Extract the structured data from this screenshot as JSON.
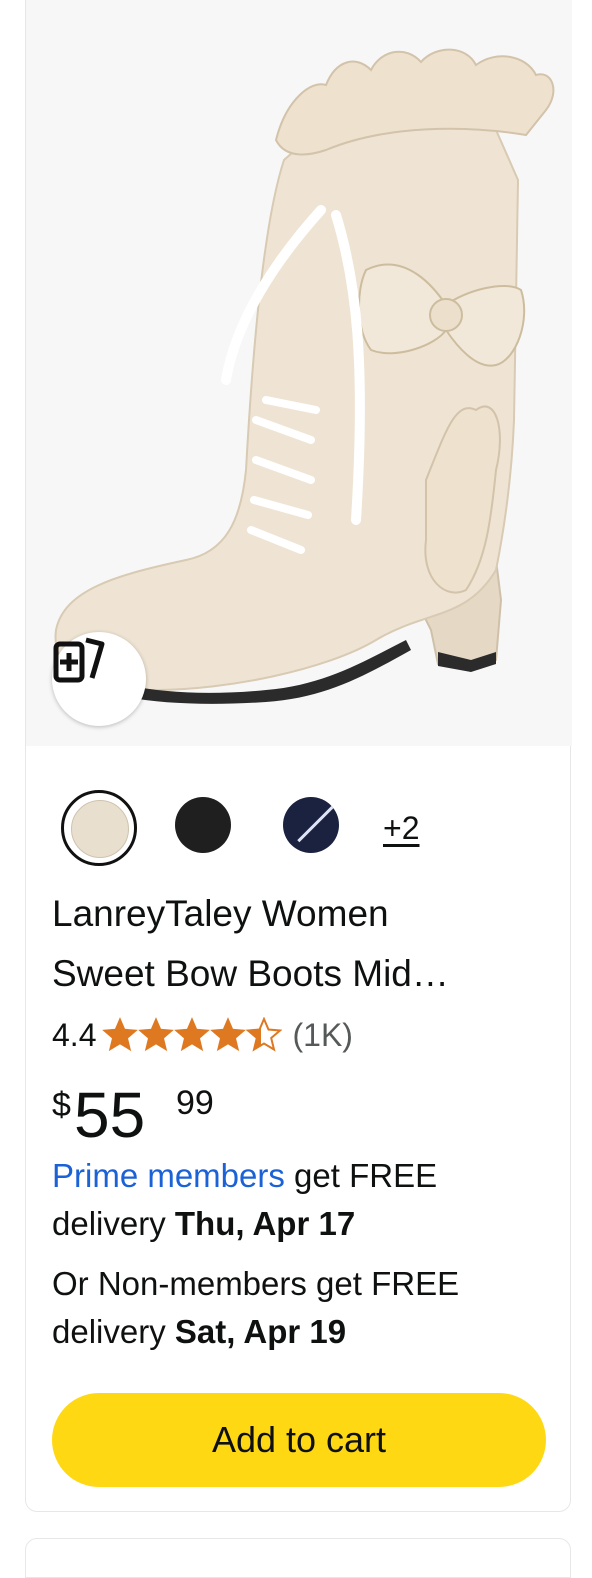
{
  "product": {
    "image_alt": "Beige lace-up heeled boot with ruffle trim and bow",
    "compare_icon": "add-to-compare-icon",
    "swatches": [
      {
        "name": "Beige",
        "color": "#e9dfcf",
        "selected": true
      },
      {
        "name": "Black",
        "color": "#1f1f1f",
        "selected": false
      },
      {
        "name": "Navy",
        "color": "#1a2240",
        "selected": false
      }
    ],
    "more_swatches": "+2",
    "title_line1": "LanreyTaley Women",
    "title_line2": "Sweet Bow Boots Mid…",
    "rating_value": "4.4",
    "rating_stars": 4.4,
    "rating_count": "(1K)",
    "star_color": "#de7921",
    "price_symbol": "$",
    "price_whole": "55",
    "price_fraction": "99",
    "prime_link": "Prime members",
    "prime_text": " get FREE delivery ",
    "prime_date": "Thu, Apr 17",
    "nonmember_text": "Or Non-members get FREE delivery ",
    "nonmember_date": "Sat, Apr 19",
    "add_to_cart": "Add to cart",
    "button_color": "#ffd814",
    "link_color": "#1a62d6"
  }
}
